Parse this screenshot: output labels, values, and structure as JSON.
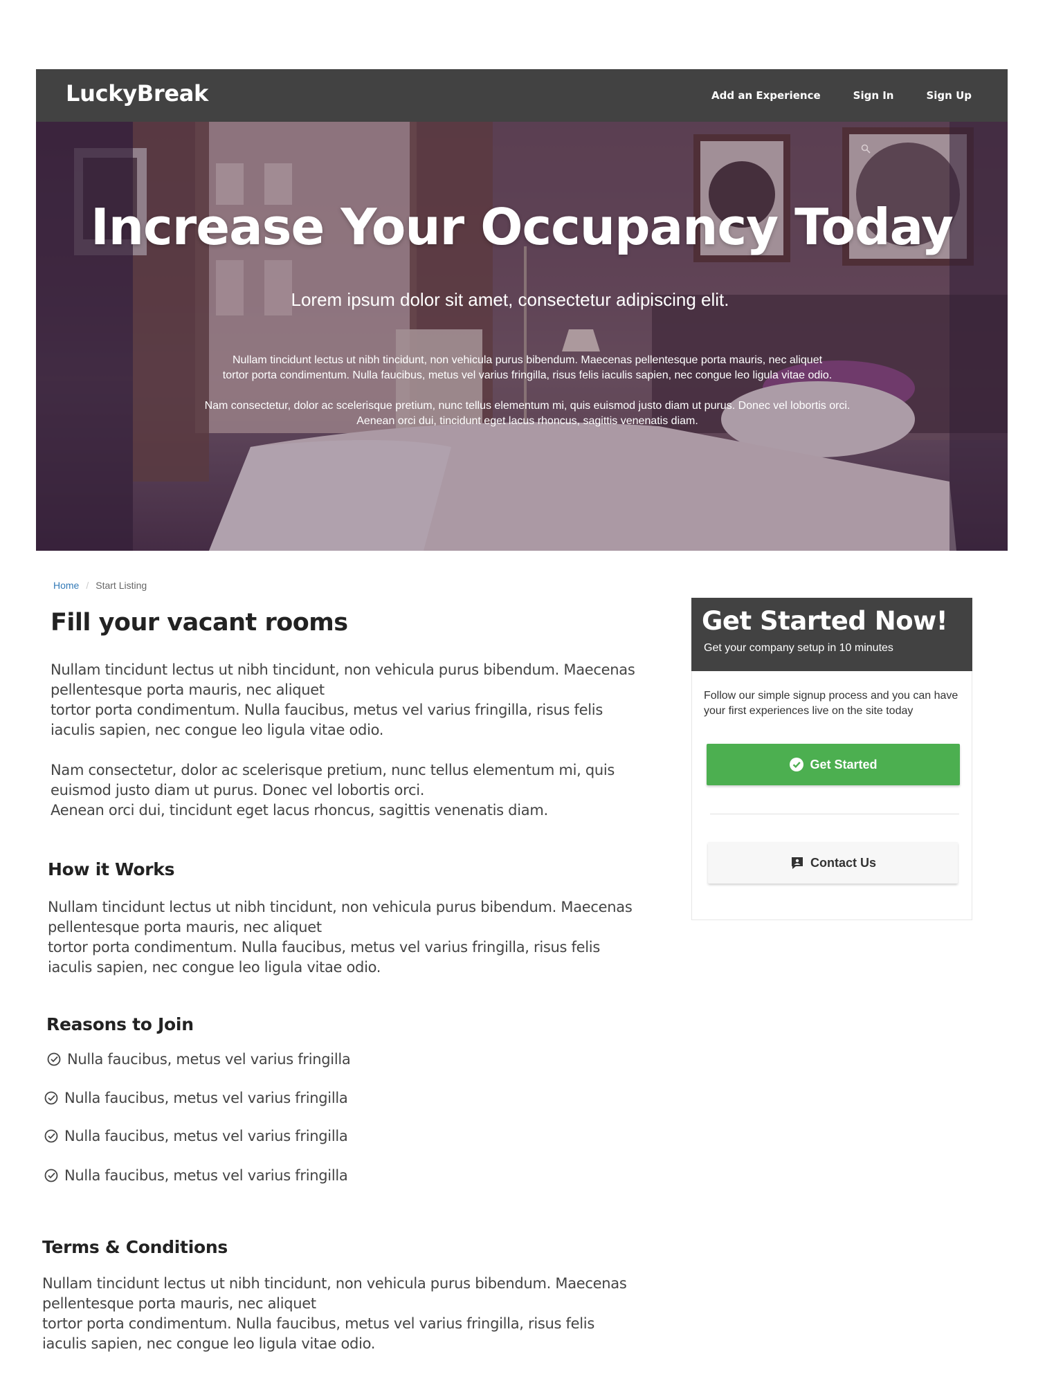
{
  "navbar": {
    "brand": "LuckyBreak",
    "links": [
      {
        "label": "Add an Experience"
      },
      {
        "label": "Sign In"
      },
      {
        "label": "Sign Up"
      }
    ]
  },
  "hero": {
    "title": "Increase Your Occupancy Today",
    "subtitle": "Lorem ipsum dolor sit amet, consectetur adipiscing elit.",
    "para1_line1": "Nullam tincidunt lectus ut nibh tincidunt, non vehicula purus bibendum. Maecenas pellentesque porta mauris, nec aliquet",
    "para1_line2": "tortor porta condimentum. Nulla faucibus, metus vel varius fringilla, risus felis iaculis sapien, nec congue leo ligula vitae odio.",
    "para2_line1": "Nam consectetur, dolor ac scelerisque pretium, nunc tellus elementum mi, quis euismod justo diam ut purus. Donec vel lobortis orci.",
    "para2_line2": "Aenean orci dui, tincidunt eget lacus rhoncus, sagittis venenatis diam."
  },
  "breadcrumb": {
    "home": "Home",
    "separator": "/",
    "current": "Start Listing"
  },
  "main": {
    "heading": "Fill your vacant rooms",
    "intro": [
      "Nullam tincidunt lectus ut nibh tincidunt, non vehicula purus bibendum. Maecenas pellentesque porta mauris, nec aliquet",
      "tortor porta condimentum. Nulla faucibus, metus vel varius fringilla, risus felis iaculis sapien, nec congue leo ligula vitae odio.",
      "Nam consectetur, dolor ac scelerisque pretium, nunc tellus elementum mi, quis euismod justo diam ut purus. Donec vel lobortis orci.",
      "Aenean orci dui, tincidunt eget lacus rhoncus, sagittis venenatis diam."
    ],
    "how_heading": "How it Works",
    "how_text": [
      "Nullam tincidunt lectus ut nibh tincidunt, non vehicula purus bibendum. Maecenas pellentesque porta mauris, nec aliquet",
      "tortor porta condimentum. Nulla faucibus, metus vel varius fringilla, risus felis iaculis sapien, nec congue leo ligula vitae odio."
    ],
    "reasons_heading": "Reasons to Join",
    "reasons": [
      "Nulla faucibus, metus vel varius fringilla",
      "Nulla faucibus, metus vel varius fringilla",
      "Nulla faucibus, metus vel varius fringilla",
      "Nulla faucibus, metus vel varius fringilla"
    ],
    "terms_heading": "Terms & Conditions",
    "terms_text": [
      "Nullam tincidunt lectus ut nibh tincidunt, non vehicula purus bibendum. Maecenas pellentesque porta mauris, nec aliquet",
      "tortor porta condimentum. Nulla faucibus, metus vel varius fringilla, risus felis iaculis sapien, nec congue leo ligula vitae odio."
    ]
  },
  "sidebar": {
    "title": "Get Started Now!",
    "subtitle": "Get your company setup in 10 minutes",
    "text": "Follow our simple signup process and you can have your first experiences live on the site today",
    "primary_button": "Get Started",
    "primary_icon": "check-circle-icon",
    "secondary_button": "Contact Us",
    "secondary_icon": "contact-chat-icon"
  },
  "colors": {
    "navbar": "#424242",
    "primary_button": "#4caf50",
    "link": "#337ab7"
  }
}
